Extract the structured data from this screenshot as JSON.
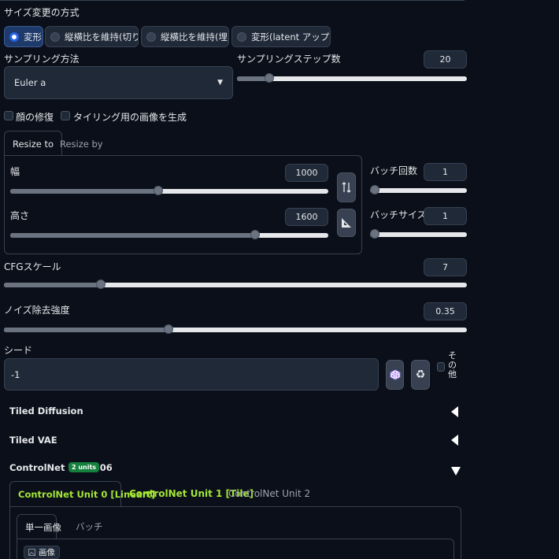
{
  "resize_mode": {
    "label": "サイズ変更の方式",
    "options": [
      {
        "label": "変形",
        "selected": true
      },
      {
        "label": "縦横比を維持(切り取り)",
        "selected": false
      },
      {
        "label": "縦横比を維持(埋める)",
        "selected": false
      },
      {
        "label": "変形(latent アップスケール)",
        "selected": false
      }
    ]
  },
  "sampling": {
    "method_label": "サンプリング方法",
    "method_value": "Euler a",
    "steps_label": "サンプリングステップ数",
    "steps_value": "20",
    "steps_fraction": 0.14
  },
  "checkboxes": {
    "face_restore": "顔の修復",
    "tiling": "タイリング用の画像を生成"
  },
  "size_tabs": {
    "tab1": "Resize to",
    "tab2": "Resize by",
    "width_label": "幅",
    "width_value": "1000",
    "width_fraction": 0.465,
    "height_label": "高さ",
    "height_value": "1600",
    "height_fraction": 0.77,
    "swap_icon": "swap-vertical-icon",
    "ratio_icon": "set-square-icon"
  },
  "batch": {
    "count_label": "バッチ回数",
    "count_value": "1",
    "count_fraction": 0.0,
    "size_label": "バッチサイズ",
    "size_value": "1",
    "size_fraction": 0.0
  },
  "cfg": {
    "label": "CFGスケール",
    "value": "7",
    "fraction": 0.21
  },
  "denoise": {
    "label": "ノイズ除去強度",
    "value": "0.35",
    "fraction": 0.355
  },
  "seed": {
    "label": "シード",
    "value": "-1",
    "dice_icon": "dice-icon",
    "recycle_icon": "recycle-icon",
    "extra_label": "その他"
  },
  "accordions": {
    "tiled_diffusion": "Tiled Diffusion",
    "tiled_vae": "Tiled VAE",
    "controlnet": "ControlNet v1.1.306",
    "controlnet_badge": "2 units"
  },
  "controlnet": {
    "tabs": [
      "ControlNet Unit 0 [Lineart]",
      "ControlNet Unit 1 [Tile]",
      "ControlNet Unit 2"
    ],
    "sub_tabs": [
      "単一画像",
      "バッチ"
    ],
    "image_label": "画像"
  },
  "colors": {
    "background": "#0b0f19",
    "input": "#1f2937",
    "accent_blue": "#2563eb",
    "accent_green": "#a3e635",
    "badge_green": "#15803d"
  }
}
